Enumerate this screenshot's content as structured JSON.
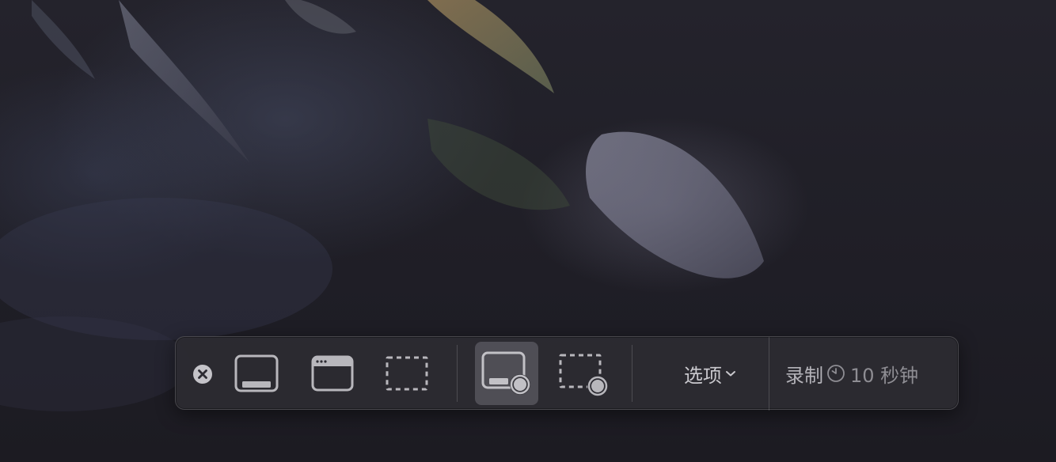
{
  "toolbar": {
    "close": {
      "icon": "close-circle-icon"
    },
    "capture_entire_screen": {
      "icon": "screen-icon"
    },
    "capture_window": {
      "icon": "window-icon"
    },
    "capture_selection": {
      "icon": "dashed-selection-icon"
    },
    "record_entire_screen": {
      "icon": "screen-record-icon",
      "selected": true
    },
    "record_selection": {
      "icon": "selection-record-icon"
    },
    "options_label": "选项",
    "options_icon": "chevron-down-icon",
    "record_label": "录制",
    "timer_icon": "timer-icon",
    "timer_text": "10 秒钟"
  },
  "colors": {
    "toolbar_bg": "#2c2b32",
    "selected_bg": "#6e6c74",
    "icon": "#b8b7bc",
    "text": "#c9c8cd"
  }
}
